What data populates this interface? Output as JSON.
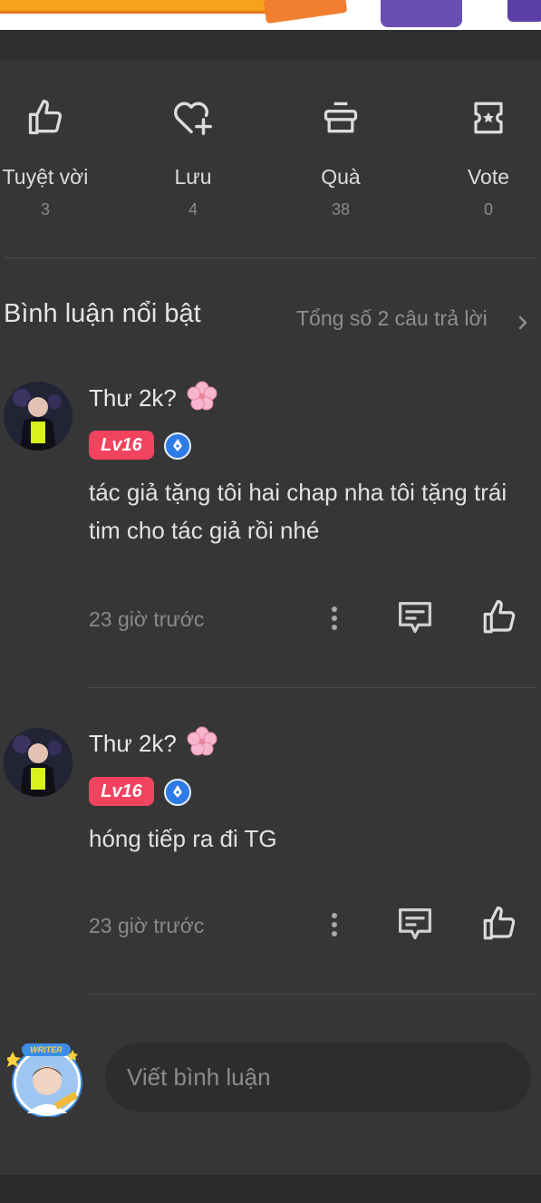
{
  "actions": [
    {
      "label": "Tuyệt vời",
      "count": "3",
      "icon": "thumbs-up-icon"
    },
    {
      "label": "Lưu",
      "count": "4",
      "icon": "heart-plus-icon"
    },
    {
      "label": "Quà",
      "count": "38",
      "icon": "gift-icon"
    },
    {
      "label": "Vote",
      "count": "0",
      "icon": "vote-ticket-icon"
    }
  ],
  "comments_section": {
    "title": "Bình luận nổi bật",
    "total": "Tổng số 2 câu trả lời"
  },
  "comments": [
    {
      "username": "Thư 2k?",
      "level": "Lv16",
      "text": "tác giả tặng tôi hai chap nha tôi tặng trái tim cho tác giả rồi nhé",
      "time": "23 giờ trước"
    },
    {
      "username": "Thư 2k?",
      "level": "Lv16",
      "text": "hóng tiếp ra đi TG",
      "time": "23 giờ trước"
    }
  ],
  "composer": {
    "avatar_badge": "WRITER",
    "placeholder": "Viết bình luận"
  },
  "colors": {
    "background": "#363636",
    "level_badge": "#f2435f",
    "writer_badge": "#2d7be6"
  }
}
